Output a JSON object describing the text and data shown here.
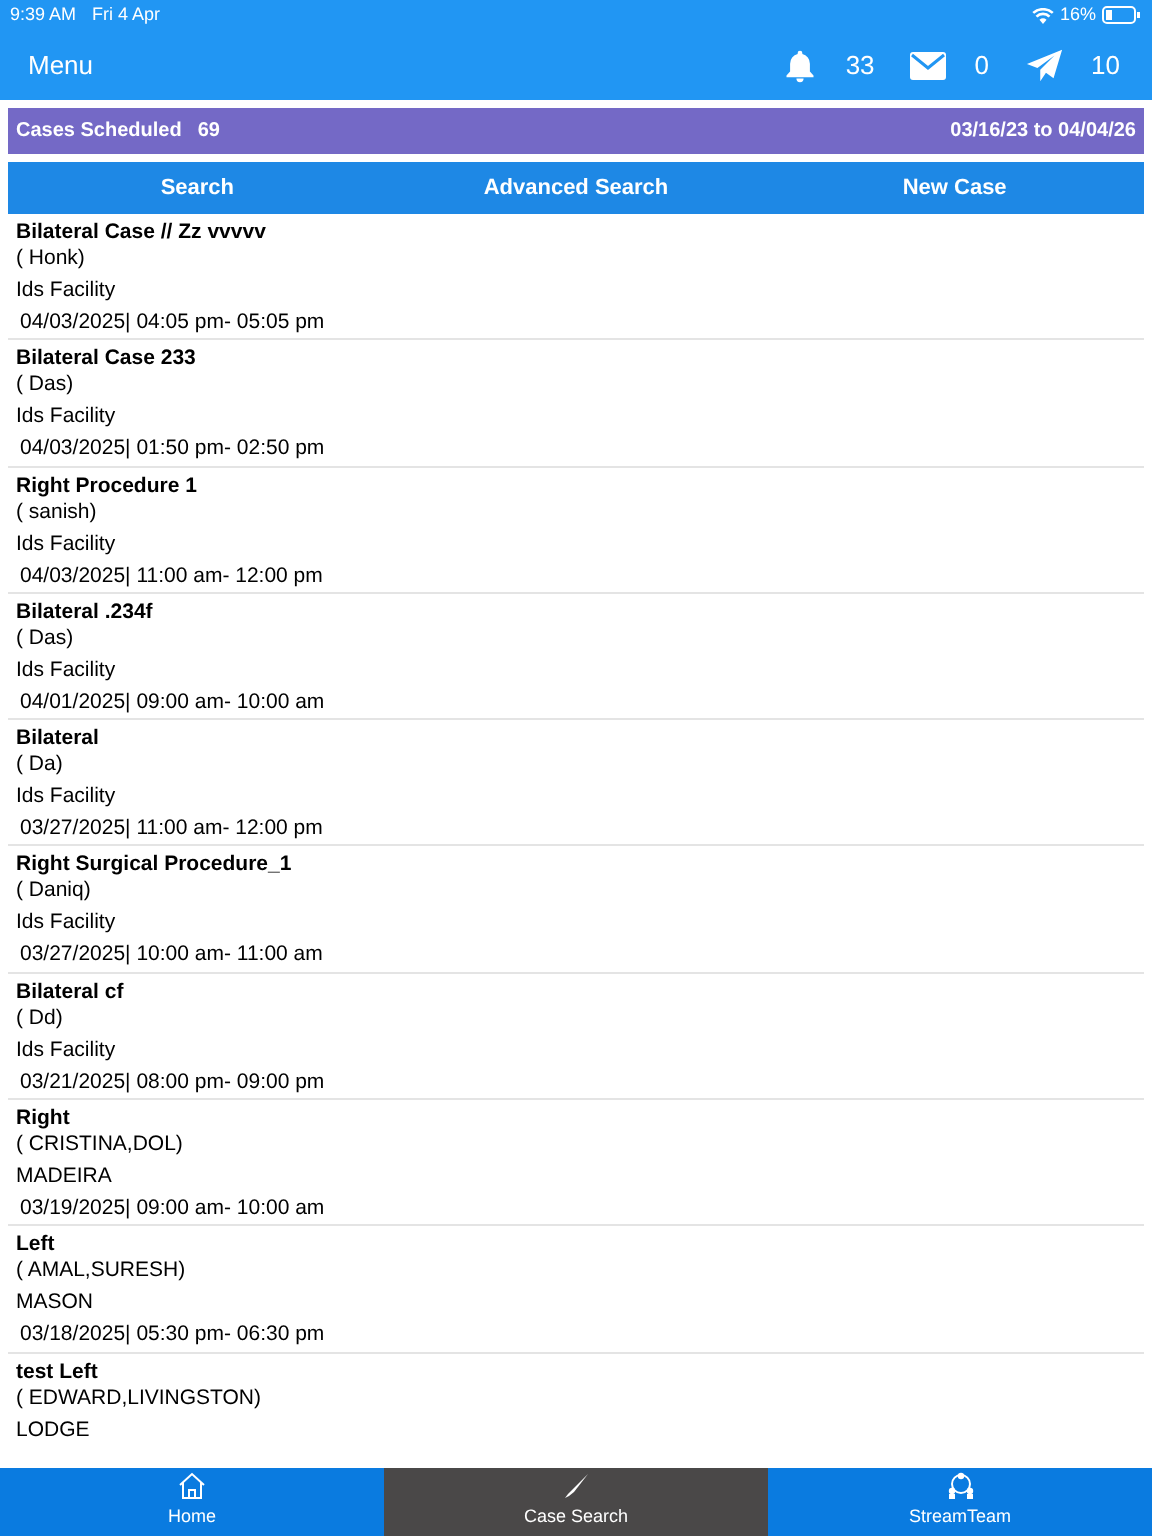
{
  "status_bar": {
    "time": "9:39 AM",
    "date": "Fri 4 Apr",
    "battery": "16%"
  },
  "header": {
    "menu": "Menu",
    "counters": [
      {
        "kind": "bell",
        "count": "33"
      },
      {
        "kind": "mail",
        "count": "0"
      },
      {
        "kind": "send",
        "count": "10"
      }
    ]
  },
  "summary": {
    "label": "Cases Scheduled",
    "count": "69",
    "range": "03/16/23 to 04/04/26"
  },
  "actions": [
    "Search",
    "Advanced Search",
    "New Case"
  ],
  "cases": [
    {
      "title": "Bilateral Case // Zz vvvvv",
      "patient": "( Honk)",
      "facility": "Ids Facility",
      "time": "04/03/2025| 04:05 pm- 05:05 pm"
    },
    {
      "title": "Bilateral Case 233",
      "patient": "( Das)",
      "facility": "Ids Facility",
      "time": "04/03/2025| 01:50 pm- 02:50 pm"
    },
    {
      "title": "Right Procedure 1",
      "patient": "( sanish)",
      "facility": "Ids Facility",
      "time": "04/03/2025| 11:00 am- 12:00 pm"
    },
    {
      "title": "Bilateral .234f",
      "patient": "( Das)",
      "facility": "Ids Facility",
      "time": "04/01/2025| 09:00 am- 10:00 am"
    },
    {
      "title": "Bilateral",
      "patient": "( Da)",
      "facility": "Ids Facility",
      "time": "03/27/2025| 11:00 am- 12:00 pm"
    },
    {
      "title": "Right Surgical Procedure_1",
      "patient": "( Daniq)",
      "facility": "Ids Facility",
      "time": "03/27/2025| 10:00 am- 11:00 am"
    },
    {
      "title": "Bilateral cf",
      "patient": "( Dd)",
      "facility": "Ids Facility",
      "time": "03/21/2025| 08:00 pm- 09:00 pm"
    },
    {
      "title": "Right",
      "patient": "( CRISTINA,DOL)",
      "facility": "MADEIRA",
      "time": "03/19/2025| 09:00 am- 10:00 am"
    },
    {
      "title": "Left",
      "patient": "( AMAL,SURESH)",
      "facility": "MASON",
      "time": "03/18/2025| 05:30 pm- 06:30 pm"
    },
    {
      "title": "test  Left",
      "patient": "( EDWARD,LIVINGSTON)",
      "facility": "LODGE"
    }
  ],
  "tab_bar": [
    {
      "kind": "home",
      "label": "Home",
      "selected": false
    },
    {
      "kind": "scalpel",
      "label": "Case Search",
      "selected": true
    },
    {
      "kind": "team",
      "label": "StreamTeam",
      "selected": false
    }
  ]
}
